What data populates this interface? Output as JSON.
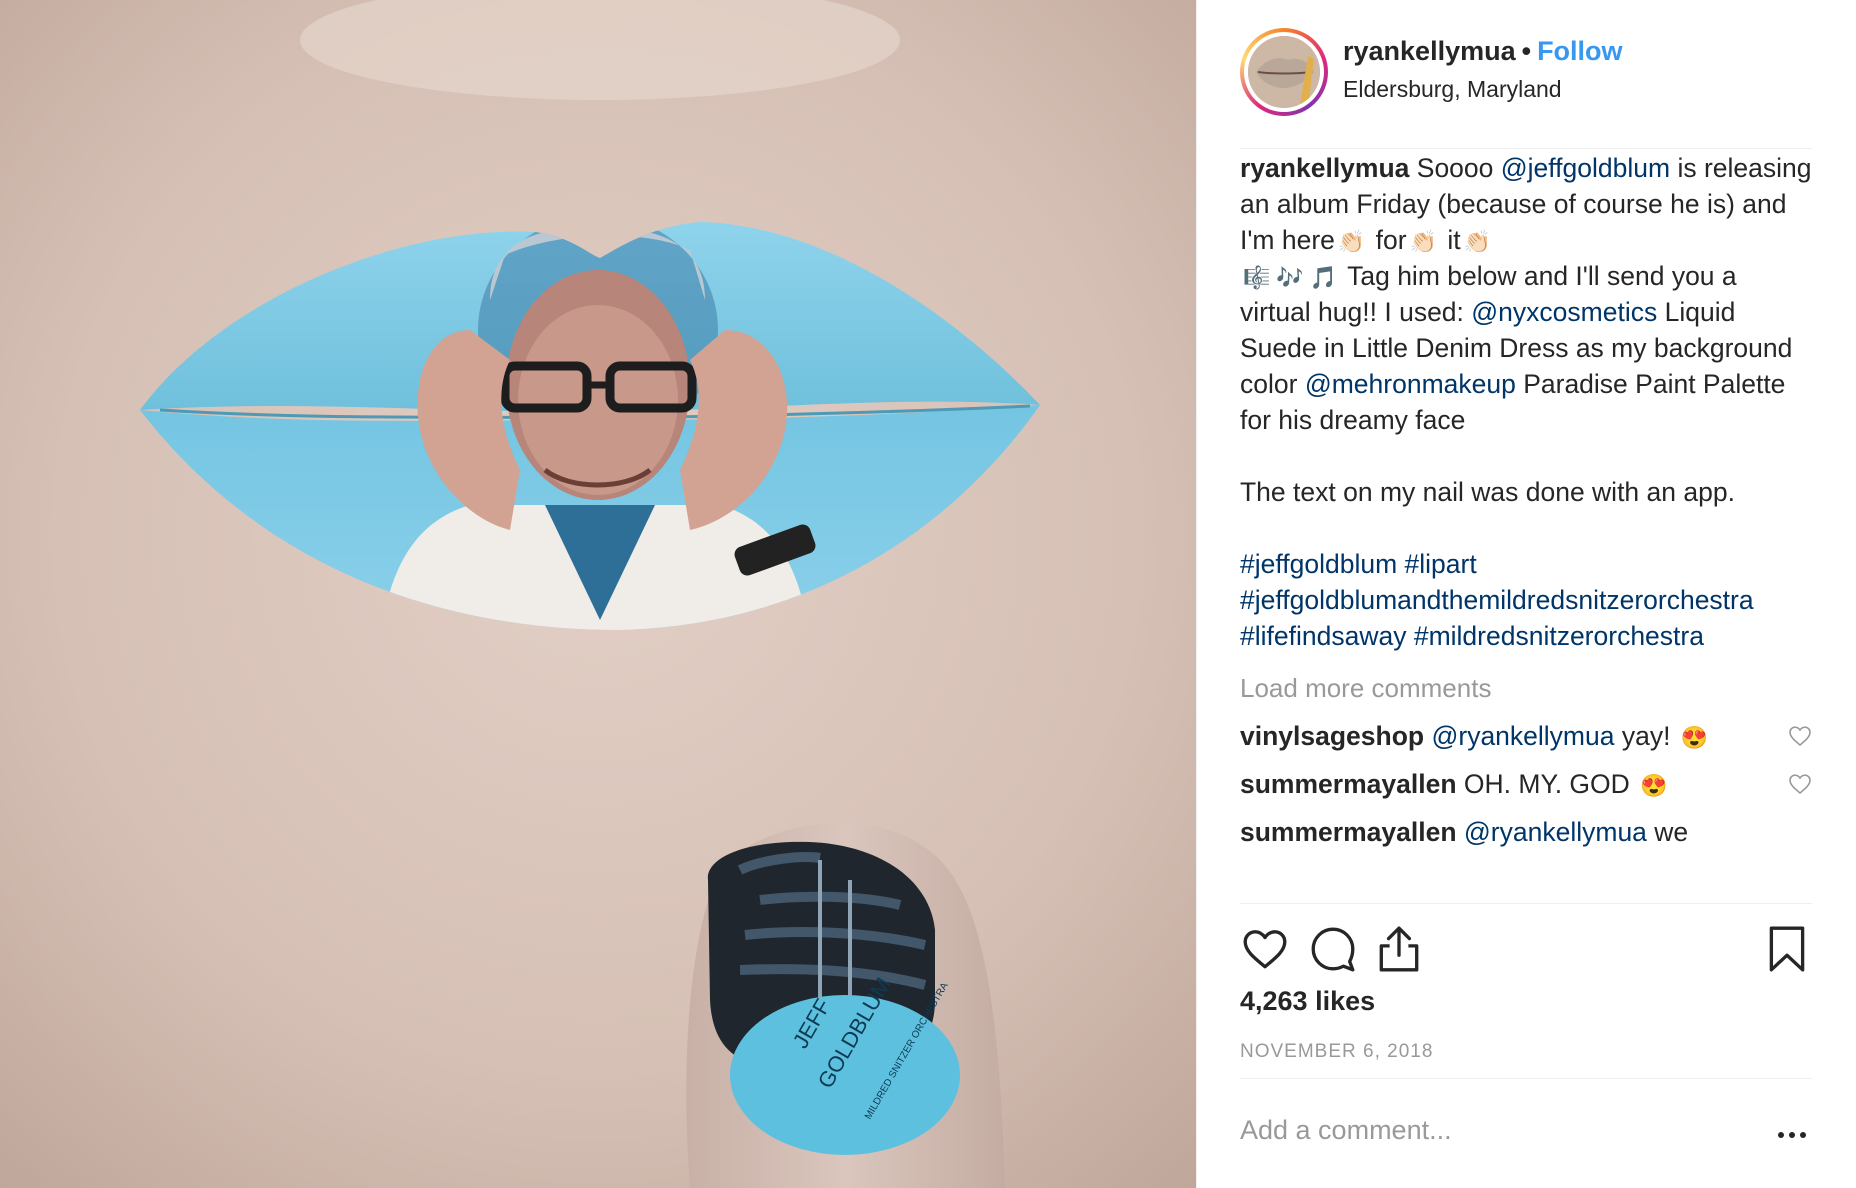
{
  "post": {
    "username": "ryankellymua",
    "follow_label": "Follow",
    "separator": "•",
    "location": "Eldersburg, Maryland"
  },
  "caption": {
    "username": "ryankellymua",
    "part1": " Soooo ",
    "mention1": "@jeffgoldblum",
    "part2": " is releasing an album Friday (because of course he is) and I'm here",
    "word_for": " for",
    "word_it": " it",
    "part3": " Tag him below and I'll send you a virtual hug!! I used: ",
    "mention2": "@nyxcosmetics",
    "part4": " Liquid Suede in Little Denim Dress as my background color ",
    "mention3": "@mehronmakeup",
    "part5": " Paradise Paint Palette for his dreamy face",
    "paragraph2": "The text on my nail was done with an app.",
    "tags": [
      "#jeffgoldblum",
      "#lipart",
      "#jeffgoldblumandthemildredsnitzerorchestra",
      "#lifefindsaway",
      "#mildredsnitzerorchestra"
    ]
  },
  "emoji": {
    "clap": "👏🏻",
    "music_score": "🎼",
    "notes": "🎶",
    "note": "🎵",
    "heart_eyes": "😍"
  },
  "load_more": "Load more comments",
  "comments": [
    {
      "user": "vinylsageshop",
      "mention": "@ryankellymua",
      "text": " yay!",
      "emoji": "😍"
    },
    {
      "user": "summermayallen",
      "mention": "",
      "text": " OH. MY. GOD",
      "emoji": "😍"
    },
    {
      "user": "summermayallen",
      "mention": "@ryankellymua",
      "text": " we",
      "emoji": ""
    }
  ],
  "stats": {
    "likes": "4,263 likes",
    "date": "NOVEMBER 6, 2018"
  },
  "composer": {
    "placeholder": "Add a comment...",
    "more_glyph": "•••"
  },
  "photo": {
    "nail_text_1": "JEFF",
    "nail_text_2": "GOLDBLUM",
    "nail_text_3": "MILDRED SNITZER ORCHESTRA"
  },
  "icons": {
    "like": "heart-icon",
    "comment": "comment-bubble-icon",
    "share": "share-icon",
    "save": "bookmark-icon",
    "comment_like": "heart-icon",
    "more": "more-options-icon"
  },
  "colors": {
    "follow": "#3897f0",
    "link": "#003569",
    "muted": "#999999",
    "text": "#262626",
    "lip": "#7fcbe6"
  }
}
